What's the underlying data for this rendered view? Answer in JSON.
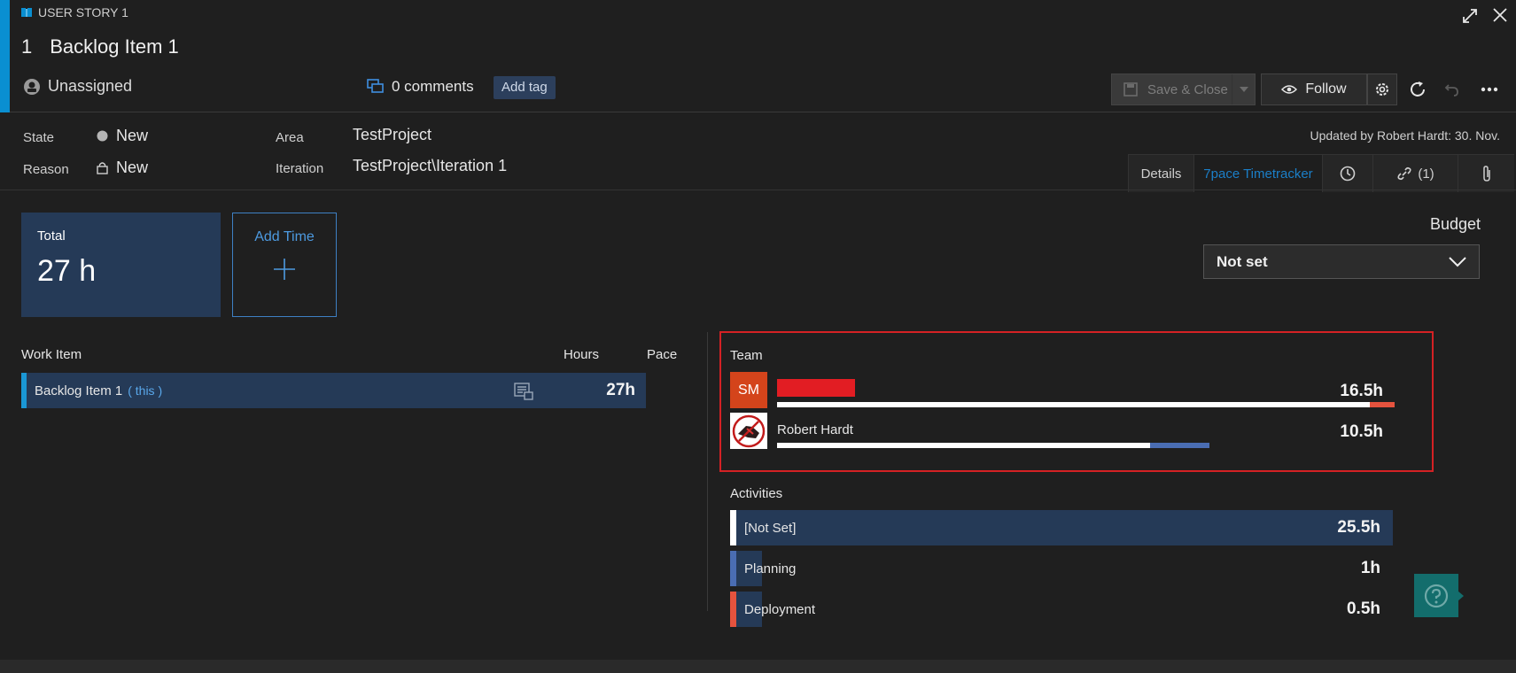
{
  "header": {
    "type_label": "USER STORY 1",
    "id": "1",
    "title": "Backlog Item 1",
    "assigned": "Unassigned",
    "comments": "0 comments",
    "add_tag": "Add tag",
    "save_close": "Save & Close",
    "follow": "Follow"
  },
  "fields": {
    "state_label": "State",
    "state_value": "New",
    "reason_label": "Reason",
    "reason_value": "New",
    "area_label": "Area",
    "area_value": "TestProject",
    "iteration_label": "Iteration",
    "iteration_value": "TestProject\\Iteration 1",
    "updated": "Updated by Robert Hardt: 30. Nov."
  },
  "tabs": {
    "details": "Details",
    "timetracker": "7pace Timetracker",
    "links": "(1)"
  },
  "summary": {
    "total_label": "Total",
    "total_value": "27 h",
    "add_time": "Add Time",
    "budget_label": "Budget",
    "budget_value": "Not set"
  },
  "work_items": {
    "col_work_item": "Work Item",
    "col_hours": "Hours",
    "col_pace": "Pace",
    "rows": [
      {
        "name": "Backlog Item 1",
        "tag": "( this )",
        "hours": "27h"
      }
    ]
  },
  "team": {
    "title": "Team",
    "members": [
      {
        "initials": "SM",
        "name": "",
        "hours": "16.5h",
        "fraction": 0.96
      },
      {
        "initials": "",
        "name": "Robert Hardt",
        "hours": "10.5h",
        "fraction": 0.63
      }
    ]
  },
  "activities": {
    "title": "Activities",
    "items": [
      {
        "label": "[Not Set]",
        "hours": "25.5h",
        "color": "#ffffff",
        "fraction": 1.0
      },
      {
        "label": "Planning",
        "hours": "1h",
        "color": "#4a6db3",
        "fraction": 0.045
      },
      {
        "label": "Deployment",
        "hours": "0.5h",
        "color": "#e5533e",
        "fraction": 0.028
      }
    ]
  },
  "colors": {
    "accent": "#0a8fd1",
    "card_bg": "#253a57",
    "highlight_border": "#d42124",
    "link_blue": "#1b7fc8"
  }
}
